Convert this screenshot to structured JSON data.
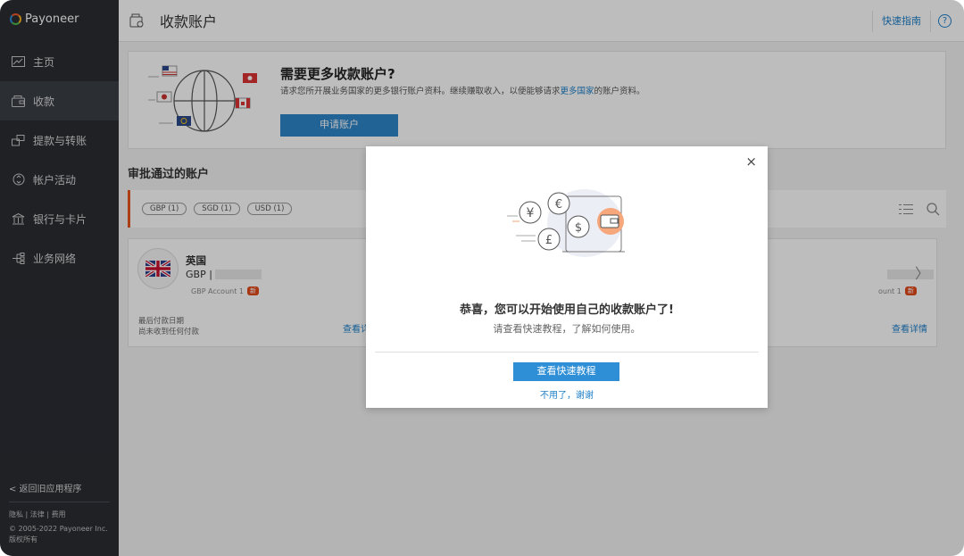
{
  "sidebar": {
    "logo": "Payoneer",
    "items": [
      {
        "label": "主页",
        "icon": "chart-icon"
      },
      {
        "label": "收款",
        "icon": "wallet-icon"
      },
      {
        "label": "提款与转账",
        "icon": "transfer-icon"
      },
      {
        "label": "帐户活动",
        "icon": "activity-icon"
      },
      {
        "label": "银行与卡片",
        "icon": "bank-icon"
      },
      {
        "label": "业务网络",
        "icon": "network-icon"
      }
    ],
    "back_link": "< 返回旧应用程序",
    "legal": [
      "隐私",
      "法律",
      "费用"
    ],
    "copyright": "© 2005-2022 Payoneer Inc.版权所有"
  },
  "header": {
    "title": "收款账户",
    "guide_link": "快速指南",
    "help": "?"
  },
  "promo": {
    "title": "需要更多收款账户?",
    "desc_before": "请求您所开展业务国家的更多银行账户资料。继续赚取收入，以便能够请求",
    "desc_link": "更多国家",
    "desc_after": "的账户资料。",
    "button": "申请账户"
  },
  "approved": {
    "title": "审批通过的账户",
    "chips": [
      "GBP (1)",
      "SGD (1)",
      "USD (1)"
    ]
  },
  "cards": [
    {
      "country": "英国",
      "currency": "GBP |",
      "account_label": "GBP Account 1",
      "badge": "新",
      "last_payment_label": "最后付款日期",
      "last_payment_value": "尚未收到任何付款",
      "view": "查看详情"
    },
    {
      "account_label": "ount 1",
      "badge": "新",
      "view": "查看详情"
    }
  ],
  "modal": {
    "close": "×",
    "title": "恭喜，您可以开始使用自己的收款账户了!",
    "subtitle": "请查看快速教程，了解如何使用。",
    "primary": "查看快速教程",
    "secondary": "不用了，谢谢"
  },
  "colors": {
    "sidebar_bg": "#2a2d33",
    "accent_blue": "#2f86c9",
    "accent_orange": "#e8541e"
  }
}
